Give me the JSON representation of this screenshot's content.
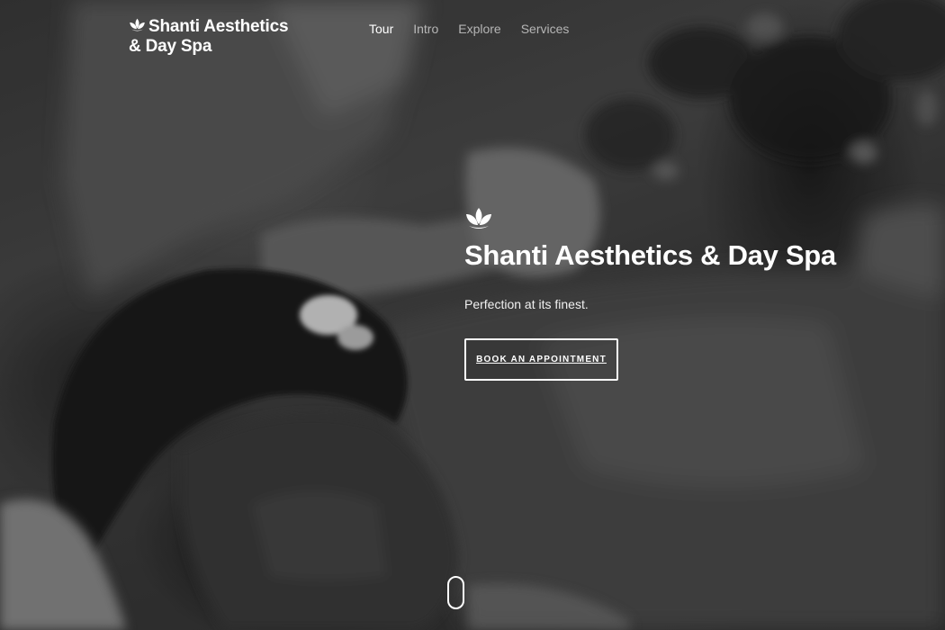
{
  "brand": {
    "line1": "Shanti Aesthetics",
    "line2": "& Day Spa",
    "logo_icon": "lotus-icon"
  },
  "nav": {
    "items": [
      {
        "label": "Tour",
        "active": true
      },
      {
        "label": "Intro",
        "active": false
      },
      {
        "label": "Explore",
        "active": false
      },
      {
        "label": "Services",
        "active": false
      }
    ]
  },
  "hero": {
    "icon": "lotus-icon",
    "title": "Shanti Aesthetics & Day Spa",
    "subtitle": "Perfection at its finest.",
    "cta_label": "BOOK AN APPOINTMENT",
    "scroll_icon": "scroll-mouse-icon"
  },
  "colors": {
    "text": "#ffffff",
    "nav_inactive": "#a0a0a0",
    "background": "#3a3a3a"
  }
}
